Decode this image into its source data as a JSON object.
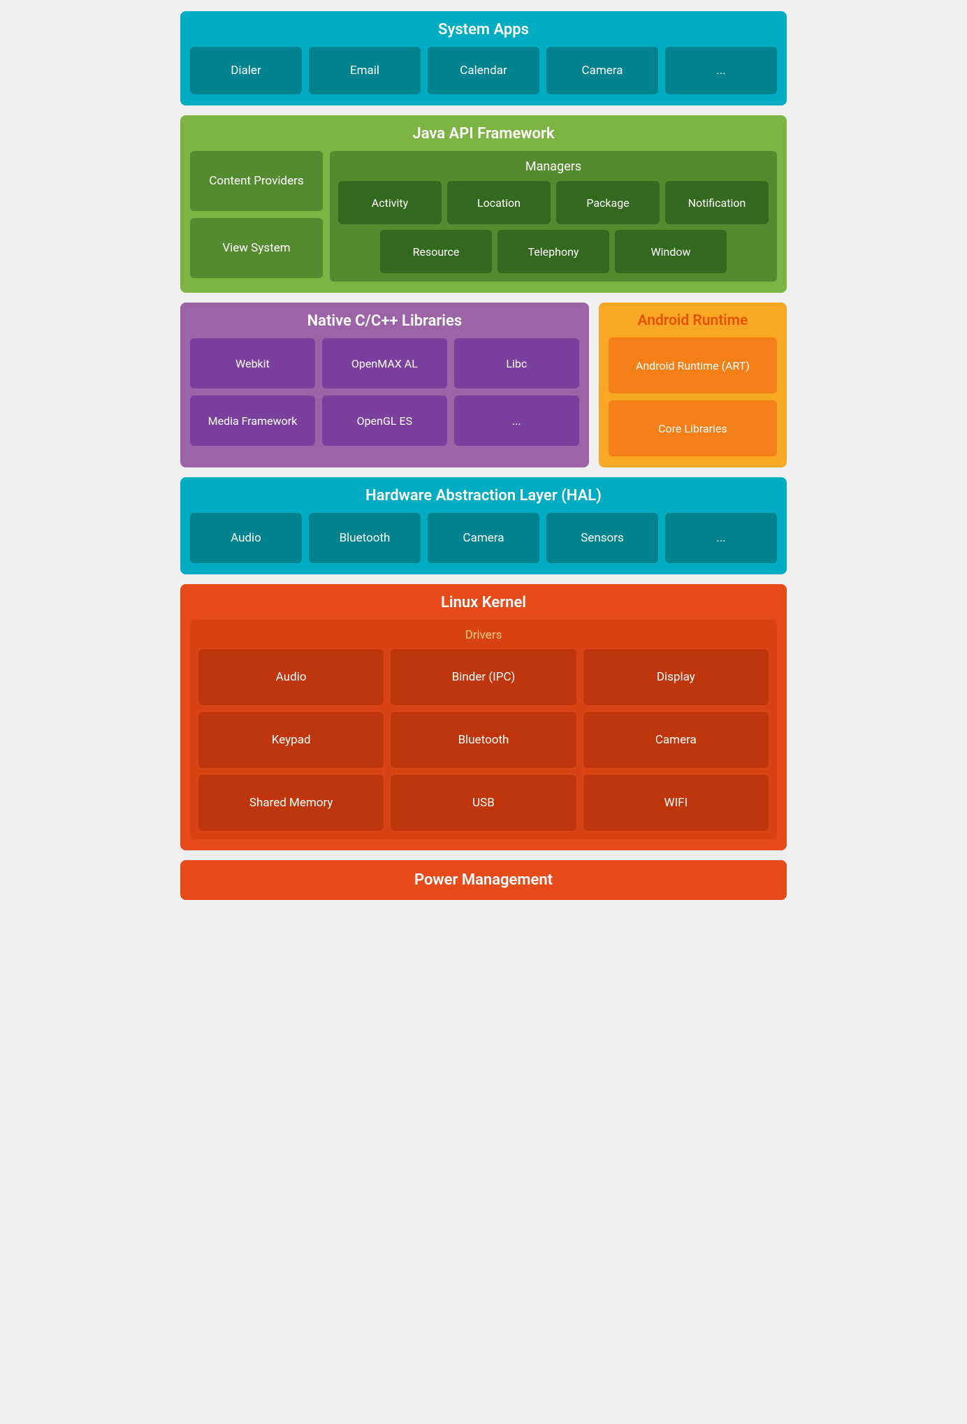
{
  "system_apps": {
    "title": "System Apps",
    "items": [
      "Dialer",
      "Email",
      "Calendar",
      "Camera",
      "..."
    ]
  },
  "java_api": {
    "title": "Java API Framework",
    "content_providers": "Content Providers",
    "view_system": "View System",
    "managers_title": "Managers",
    "managers_row1": [
      "Activity",
      "Location",
      "Package",
      "Notification"
    ],
    "managers_row2": [
      "Resource",
      "Telephony",
      "Window"
    ]
  },
  "native": {
    "title": "Native C/C++ Libraries",
    "items": [
      "Webkit",
      "OpenMAX AL",
      "Libc",
      "Media Framework",
      "OpenGL ES",
      "..."
    ]
  },
  "android_runtime": {
    "title": "Android Runtime",
    "items": [
      "Android Runtime (ART)",
      "Core Libraries"
    ]
  },
  "hal": {
    "title": "Hardware Abstraction Layer (HAL)",
    "items": [
      "Audio",
      "Bluetooth",
      "Camera",
      "Sensors",
      "..."
    ]
  },
  "linux": {
    "title": "Linux Kernel",
    "drivers_title": "Drivers",
    "drivers": [
      "Audio",
      "Binder (IPC)",
      "Display",
      "Keypad",
      "Bluetooth",
      "Camera",
      "Shared Memory",
      "USB",
      "WIFI"
    ]
  },
  "power": {
    "title": "Power Management"
  }
}
